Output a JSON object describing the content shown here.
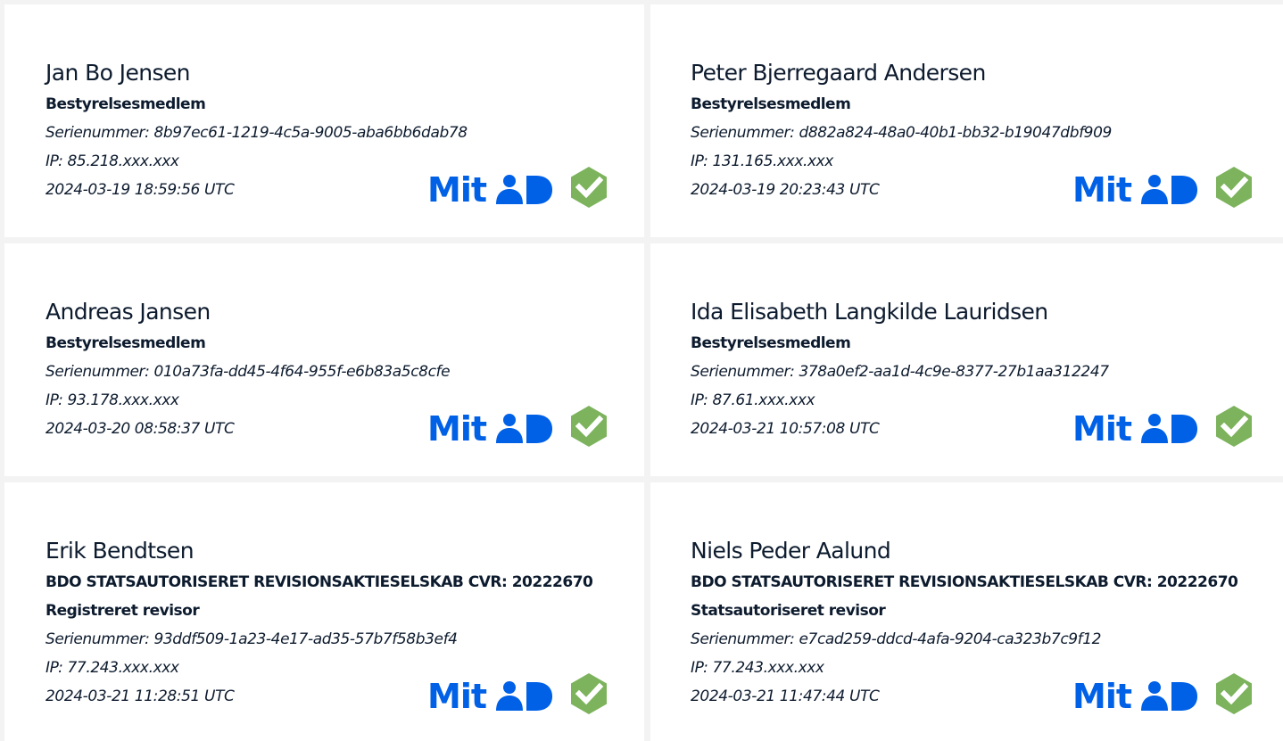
{
  "brand": {
    "logo_text": "Mit",
    "logo_color": "#0060e6",
    "check_color": "#7cb35c"
  },
  "signatures": [
    {
      "name": "Jan Bo Jensen",
      "roles": [
        "Bestyrelsesmedlem"
      ],
      "serial": "Serienummer: 8b97ec61-1219-4c5a-9005-aba6bb6dab78",
      "ip": "IP: 85.218.xxx.xxx",
      "timestamp": "2024-03-19 18:59:56 UTC"
    },
    {
      "name": "Peter Bjerregaard Andersen",
      "roles": [
        "Bestyrelsesmedlem"
      ],
      "serial": "Serienummer: d882a824-48a0-40b1-bb32-b19047dbf909",
      "ip": "IP: 131.165.xxx.xxx",
      "timestamp": "2024-03-19 20:23:43 UTC"
    },
    {
      "name": "Andreas Jansen",
      "roles": [
        "Bestyrelsesmedlem"
      ],
      "serial": "Serienummer: 010a73fa-dd45-4f64-955f-e6b83a5c8cfe",
      "ip": "IP: 93.178.xxx.xxx",
      "timestamp": "2024-03-20 08:58:37 UTC"
    },
    {
      "name": "Ida Elisabeth Langkilde Lauridsen",
      "roles": [
        "Bestyrelsesmedlem"
      ],
      "serial": "Serienummer: 378a0ef2-aa1d-4c9e-8377-27b1aa312247",
      "ip": "IP: 87.61.xxx.xxx",
      "timestamp": "2024-03-21 10:57:08 UTC"
    },
    {
      "name": "Erik Bendtsen",
      "roles": [
        "BDO STATSAUTORISERET REVISIONSAKTIESELSKAB CVR: 20222670",
        "Registreret revisor"
      ],
      "serial": "Serienummer: 93ddf509-1a23-4e17-ad35-57b7f58b3ef4",
      "ip": "IP: 77.243.xxx.xxx",
      "timestamp": "2024-03-21 11:28:51 UTC"
    },
    {
      "name": "Niels Peder Aalund",
      "roles": [
        "BDO STATSAUTORISERET REVISIONSAKTIESELSKAB CVR: 20222670",
        "Statsautoriseret revisor"
      ],
      "serial": "Serienummer: e7cad259-ddcd-4afa-9204-ca323b7c9f12",
      "ip": "IP: 77.243.xxx.xxx",
      "timestamp": "2024-03-21 11:47:44 UTC"
    }
  ]
}
